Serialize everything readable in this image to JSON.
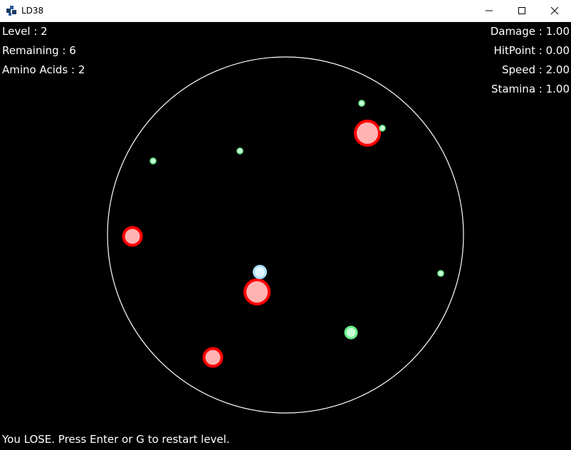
{
  "window": {
    "title": "LD38",
    "icon": "ld38-app-icon",
    "controls": [
      "minimize-icon",
      "maximize-icon",
      "close-icon"
    ]
  },
  "hud": {
    "level": "Level : 2",
    "remaining": "Remaining : 6",
    "amino_acids": "Amino Acids : 2",
    "damage": "Damage : 1.00",
    "hitpoint": "HitPoint : 0.00",
    "speed": "Speed : 2.00",
    "stamina": "Stamina : 1.00"
  },
  "status_message": "You LOSE. Press Enter or G to restart level.",
  "colors": {
    "background": "#000000",
    "arena_border": "#ffffff",
    "enemy_fill": "#ffb3b3",
    "enemy_stroke": "#ff0000",
    "amino_fill": "#c8ffd8",
    "amino_stroke": "#66ee88",
    "player_fill": "#dff6ff",
    "player_stroke": "#aaddff"
  }
}
